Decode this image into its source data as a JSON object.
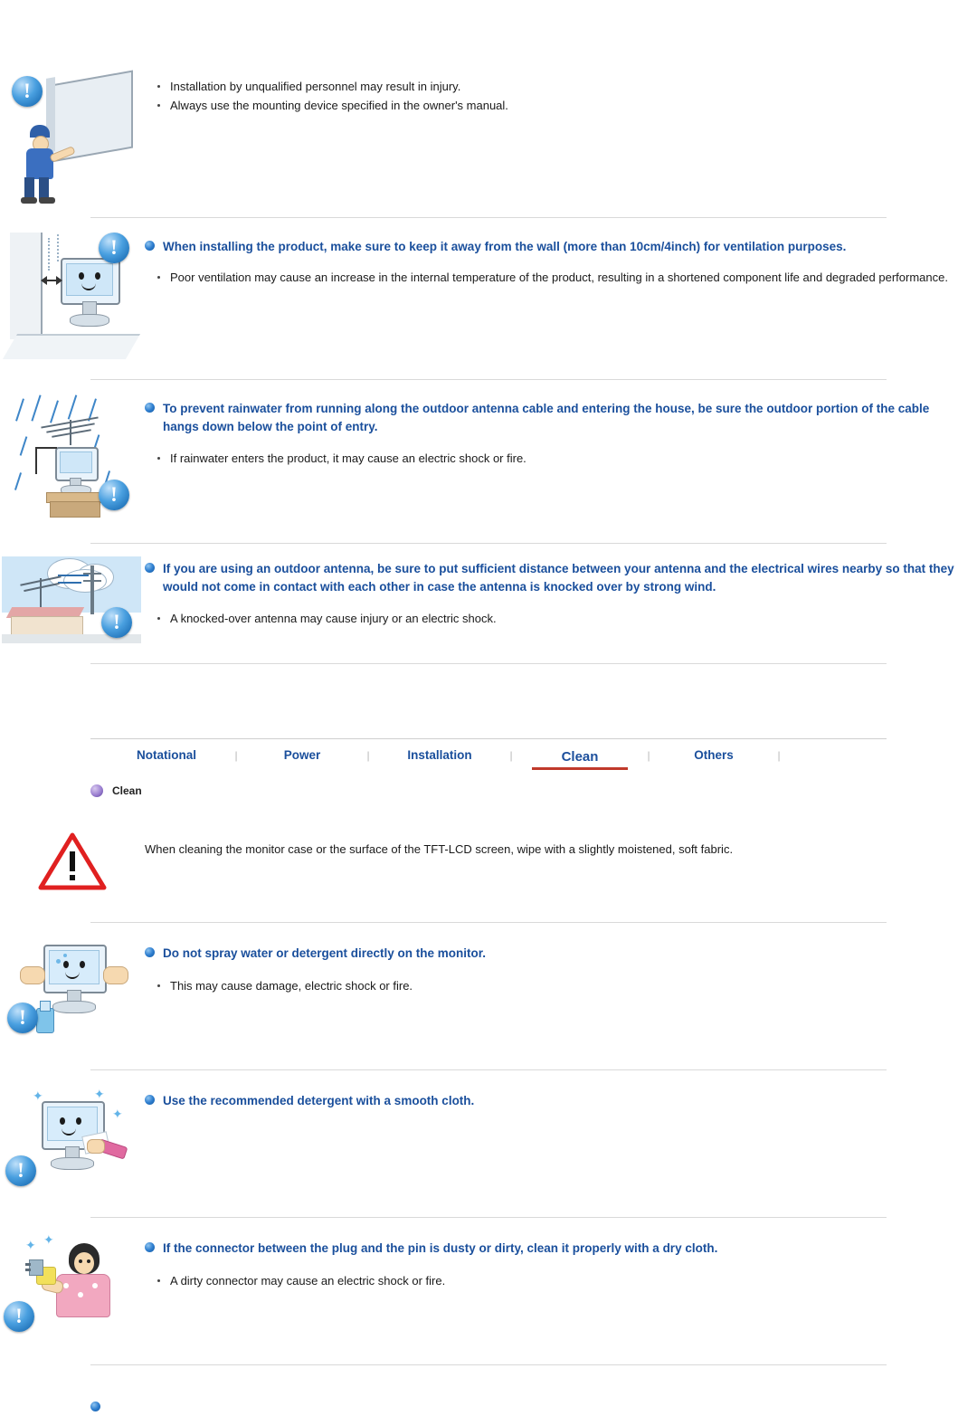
{
  "sections": [
    {
      "id": "mounting",
      "icon": "installer-wall-mount-illustration",
      "heading": "",
      "items": [
        "Installation by unqualified personnel may result in injury.",
        "Always use the mounting device specified in the owner's manual."
      ]
    },
    {
      "id": "ventilation",
      "icon": "monitor-near-wall-illustration",
      "heading": "When installing the product, make sure to keep it away from the wall (more than 10cm/4inch) for ventilation purposes.",
      "items": [
        "Poor ventilation may cause an increase in the internal temperature of the product, resulting in a shortened component life and degraded performance."
      ]
    },
    {
      "id": "rainwater",
      "icon": "antenna-rain-illustration",
      "heading": "To prevent rainwater from running along the outdoor antenna cable and entering the house, be sure the outdoor portion of the cable hangs down below the point of entry.",
      "items": [
        "If rainwater enters the product, it may cause an electric shock or fire."
      ]
    },
    {
      "id": "outdoor-antenna",
      "icon": "antenna-power-line-illustration",
      "heading": "If you are using an outdoor antenna, be sure to put sufficient distance between your antenna and the electrical wires nearby so that they would not come in contact with each other in case the antenna is knocked over by strong wind.",
      "items": [
        "A knocked-over antenna may cause injury or an electric shock."
      ]
    }
  ],
  "nav": {
    "items": [
      {
        "label": "Notational",
        "active": false
      },
      {
        "label": "Power",
        "active": false
      },
      {
        "label": "Installation",
        "active": false
      },
      {
        "label": "Clean",
        "active": true
      },
      {
        "label": "Others",
        "active": false
      }
    ],
    "separator": "|",
    "accent_color": "#c0392b",
    "link_color": "#1a4f9c"
  },
  "clean": {
    "label": "Clean",
    "intro": "When cleaning the monitor case or the surface of the TFT-LCD screen, wipe with a slightly moistened, soft fabric.",
    "sections": [
      {
        "id": "no-spray",
        "icon": "spray-bottle-monitor-illustration",
        "heading": "Do not spray water or detergent directly on the monitor.",
        "items": [
          "This may cause damage, electric shock or fire."
        ]
      },
      {
        "id": "recommended-detergent",
        "icon": "cloth-wipe-monitor-illustration",
        "heading": "Use the recommended detergent with a smooth cloth.",
        "items": []
      },
      {
        "id": "dusty-connector",
        "icon": "person-cleaning-plug-illustration",
        "heading": "If the connector between the plug and the pin is dusty or dirty, clean it properly with a dry cloth.",
        "items": [
          "A dirty connector may cause an electric shock or fire."
        ]
      }
    ]
  },
  "icons": {
    "exclamation": "!",
    "warning_triangle": "warning-triangle-icon"
  }
}
